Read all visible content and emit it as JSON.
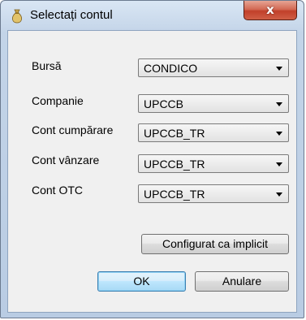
{
  "window": {
    "title": "Selectați contul",
    "close_label": "x",
    "icon": "moneybag-icon"
  },
  "fields": [
    {
      "label": "Bursă",
      "value": "CONDICO"
    },
    {
      "label": "Companie",
      "value": "UPCCB"
    },
    {
      "label": "Cont cumpărare",
      "value": "UPCCB_TR"
    },
    {
      "label": "Cont vânzare",
      "value": "UPCCB_TR"
    },
    {
      "label": "Cont OTC",
      "value": "UPCCB_TR"
    }
  ],
  "buttons": {
    "set_default": "Configurat ca implicit",
    "ok": "OK",
    "cancel": "Anulare"
  }
}
